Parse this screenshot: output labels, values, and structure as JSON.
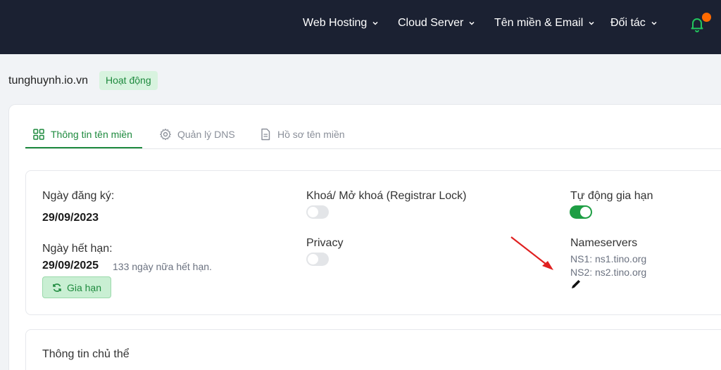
{
  "nav": {
    "items": [
      {
        "label": "Web Hosting"
      },
      {
        "label": "Cloud Server"
      },
      {
        "label": "Tên miền & Email"
      },
      {
        "label": "Đối tác"
      }
    ],
    "bell_icon": "bell-icon",
    "notification_dot_color": "#ff6a00"
  },
  "domain": {
    "name": "tunghuynh.io.vn",
    "status": "Hoạt động"
  },
  "tabs": [
    {
      "label": "Thông tin tên miền",
      "icon": "grid-icon",
      "active": true
    },
    {
      "label": "Quản lý DNS",
      "icon": "gear-icon",
      "active": false
    },
    {
      "label": "Hồ sơ tên miền",
      "icon": "document-icon",
      "active": false
    }
  ],
  "info": {
    "registered_label": "Ngày đăng ký:",
    "registered_value": "29/09/2023",
    "expiry_label": "Ngày hết hạn:",
    "expiry_value": "29/09/2025",
    "expiry_note": "133 ngày nữa hết hạn.",
    "renew_label": "Gia hạn",
    "registrar_lock_label": "Khoá/ Mở khoá (Registrar Lock)",
    "registrar_lock_on": false,
    "privacy_label": "Privacy",
    "privacy_on": false,
    "auto_renew_label": "Tự động gia hạn",
    "auto_renew_on": true,
    "nameservers_label": "Nameservers",
    "ns1": "NS1: ns1.tino.org",
    "ns2": "NS2: ns2.tino.org"
  },
  "owner": {
    "title": "Thông tin chủ thể"
  },
  "colors": {
    "accent": "#1e8a3e",
    "topbar": "#1b2132",
    "annotation_arrow": "#e02020"
  }
}
